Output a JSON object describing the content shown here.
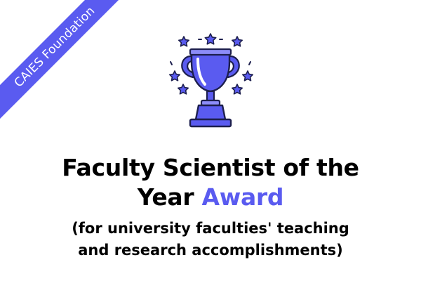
{
  "ribbon": {
    "text": "CAIES Foundation"
  },
  "trophy": {
    "icon": "trophy-icon",
    "stars_icon": "star-icon"
  },
  "title": {
    "line1": "Faculty Scientist of the",
    "line2_prefix": "Year ",
    "line2_accent": "Award"
  },
  "subtitle": {
    "line1": "(for university faculties' teaching",
    "line2": "and research accomplishments)"
  },
  "colors": {
    "accent": "#5a5bf0",
    "accent_light": "#8c8cf8",
    "dark": "#1d1f4e",
    "text": "#000000"
  }
}
